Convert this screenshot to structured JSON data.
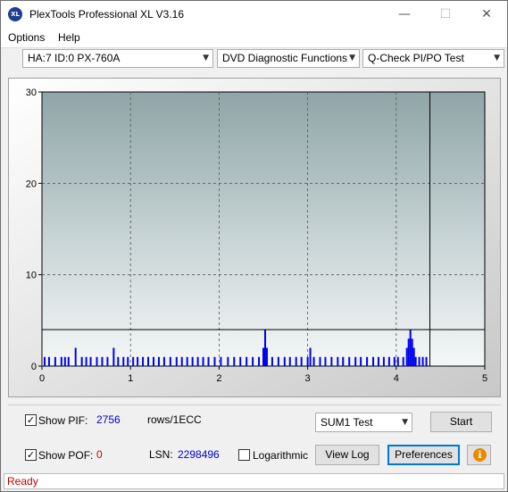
{
  "window": {
    "title": "PlexTools Professional XL V3.16",
    "icon_label": "XL"
  },
  "titlebar_buttons": {
    "minimize": "—",
    "maximize": "☐",
    "close": "✕"
  },
  "menu": [
    {
      "label": "Options"
    },
    {
      "label": "Help"
    }
  ],
  "toolbar": {
    "drive": "HA:7 ID:0  PX-760A",
    "function": "DVD Diagnostic Functions",
    "test": "Q-Check PI/PO Test",
    "arrow": "▼"
  },
  "chart_data": {
    "type": "bar",
    "title": "",
    "xlabel": "",
    "ylabel": "",
    "xlim": [
      0,
      5
    ],
    "ylim": [
      0,
      30
    ],
    "x_ticks": [
      "0",
      "1",
      "2",
      "3",
      "4",
      "5"
    ],
    "y_ticks": [
      "0",
      "10",
      "20",
      "30"
    ],
    "grid": true,
    "threshold_line": 4,
    "end_marker_x": 4.38,
    "series": [
      {
        "color": "#0000ee",
        "points": [
          [
            0.03,
            1
          ],
          [
            0.08,
            1
          ],
          [
            0.15,
            1
          ],
          [
            0.22,
            1
          ],
          [
            0.26,
            1
          ],
          [
            0.3,
            1
          ],
          [
            0.38,
            2
          ],
          [
            0.45,
            1
          ],
          [
            0.5,
            1
          ],
          [
            0.55,
            1
          ],
          [
            0.62,
            1
          ],
          [
            0.68,
            1
          ],
          [
            0.74,
            1
          ],
          [
            0.81,
            2
          ],
          [
            0.86,
            1
          ],
          [
            0.92,
            1
          ],
          [
            0.97,
            1
          ],
          [
            1.03,
            1
          ],
          [
            1.08,
            1
          ],
          [
            1.14,
            1
          ],
          [
            1.2,
            1
          ],
          [
            1.26,
            1
          ],
          [
            1.32,
            1
          ],
          [
            1.38,
            1
          ],
          [
            1.45,
            1
          ],
          [
            1.52,
            1
          ],
          [
            1.58,
            1
          ],
          [
            1.64,
            1
          ],
          [
            1.7,
            1
          ],
          [
            1.76,
            1
          ],
          [
            1.82,
            1
          ],
          [
            1.88,
            1
          ],
          [
            1.95,
            1
          ],
          [
            2.02,
            1
          ],
          [
            2.1,
            1
          ],
          [
            2.17,
            1
          ],
          [
            2.24,
            1
          ],
          [
            2.31,
            1
          ],
          [
            2.38,
            1
          ],
          [
            2.45,
            1
          ],
          [
            2.5,
            2
          ],
          [
            2.52,
            4
          ],
          [
            2.54,
            2
          ],
          [
            2.6,
            1
          ],
          [
            2.67,
            1
          ],
          [
            2.74,
            1
          ],
          [
            2.8,
            1
          ],
          [
            2.87,
            1
          ],
          [
            2.93,
            1
          ],
          [
            3.0,
            1
          ],
          [
            3.03,
            2
          ],
          [
            3.07,
            1
          ],
          [
            3.14,
            1
          ],
          [
            3.2,
            1
          ],
          [
            3.27,
            1
          ],
          [
            3.34,
            1
          ],
          [
            3.4,
            1
          ],
          [
            3.47,
            1
          ],
          [
            3.54,
            1
          ],
          [
            3.6,
            1
          ],
          [
            3.67,
            1
          ],
          [
            3.74,
            1
          ],
          [
            3.8,
            1
          ],
          [
            3.86,
            1
          ],
          [
            3.92,
            1
          ],
          [
            3.98,
            1
          ],
          [
            4.02,
            1
          ],
          [
            4.08,
            1
          ],
          [
            4.12,
            2
          ],
          [
            4.14,
            3
          ],
          [
            4.16,
            4
          ],
          [
            4.18,
            3
          ],
          [
            4.2,
            2
          ],
          [
            4.22,
            1
          ],
          [
            4.26,
            1
          ],
          [
            4.3,
            1
          ],
          [
            4.34,
            1
          ]
        ]
      }
    ]
  },
  "controls": {
    "show_pif_label": "Show PIF:",
    "show_pif_checked": "✓",
    "pif_value": "2756",
    "pif_unit": "rows/1ECC",
    "show_pof_label": "Show POF:",
    "show_pof_checked": "✓",
    "pof_value": "0",
    "lsn_label": "LSN:",
    "lsn_value": "2298496",
    "logarithmic_label": "Logarithmic",
    "sum_select": "SUM1 Test",
    "start_button": "Start",
    "view_log_button": "View Log",
    "preferences_button": "Preferences",
    "info_glyph": "i"
  },
  "status": {
    "text": "Ready"
  },
  "colors": {
    "pif_value": "#0000cc",
    "pof_value": "#cc0000",
    "status_text": "#c00000",
    "bars": "#0000ee"
  }
}
